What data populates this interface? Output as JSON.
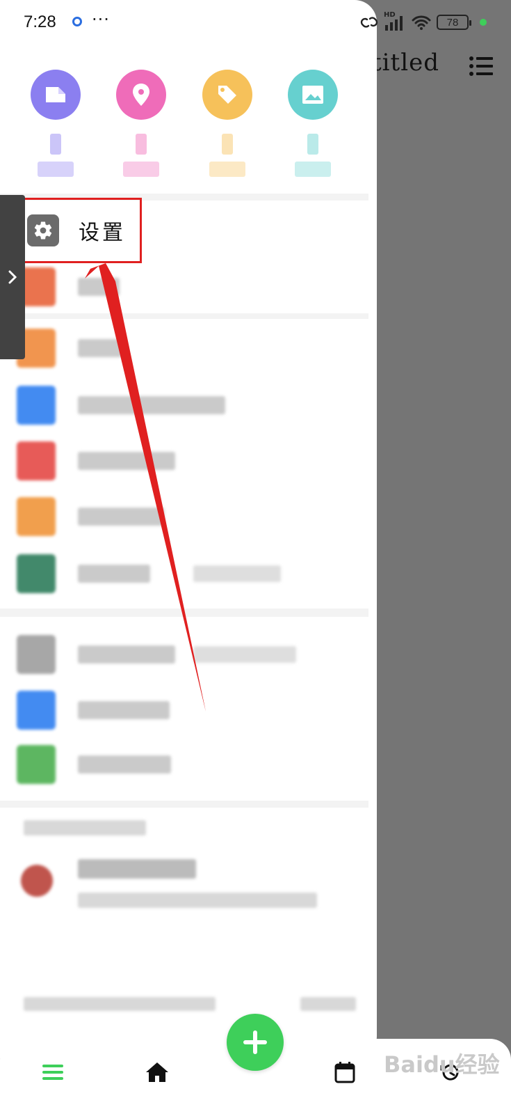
{
  "status_bar": {
    "time": "7:28",
    "more": "···",
    "battery": "78",
    "network": "HD"
  },
  "background_app": {
    "title": "titled"
  },
  "shortcuts": [
    {
      "icon": "folder-icon",
      "color": "#8b7ff0"
    },
    {
      "icon": "location-pin-icon",
      "color": "#ef6cb9"
    },
    {
      "icon": "tag-icon",
      "color": "#f6c15a"
    },
    {
      "icon": "image-icon",
      "color": "#66d0cf"
    }
  ],
  "menu": {
    "settings_label": "设置"
  },
  "blurred_rows": [
    {
      "icon_color": "#e8643b",
      "text_width": 60
    },
    {
      "icon_color": "#f08a3c",
      "text_width": 64
    },
    {
      "icon_color": "#2f7ff0",
      "text_width": 212
    },
    {
      "icon_color": "#e54a46",
      "text_width": 140
    },
    {
      "icon_color": "#f0953a",
      "text_width": 124
    },
    {
      "icon_color": "#2e7d5b",
      "text_width": 104
    },
    {
      "icon_color": "#9e9e9e",
      "text_width": 140
    },
    {
      "icon_color": "#2f7ff0",
      "text_width": 132
    },
    {
      "icon_color": "#4caf50",
      "text_width": 134
    }
  ],
  "watermark": "Baidu经验",
  "annotation": {
    "box_color": "#e02020",
    "arrow_color": "#e02020"
  }
}
